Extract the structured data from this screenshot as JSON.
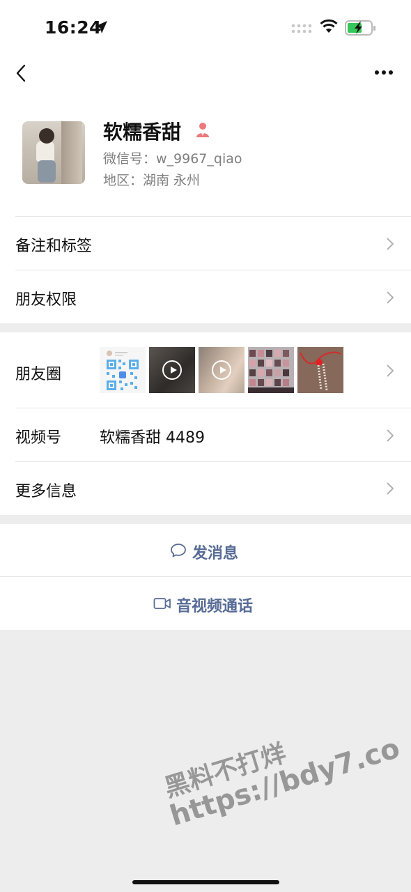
{
  "status_bar": {
    "time": "16:24"
  },
  "profile": {
    "name": "软糯香甜",
    "wechat_id": "微信号：w_9967_qiao",
    "region": "地区：湖南 永州"
  },
  "rows": {
    "remark_tags": "备注和标签",
    "friend_permissions": "朋友权限",
    "moments": "朋友圈",
    "channels": "视频号",
    "channels_value": "软糯香甜 4489",
    "more_info": "更多信息"
  },
  "actions": {
    "send_message": "发消息",
    "av_call": "音视频通话"
  },
  "watermark": {
    "line1": "黑料不打烊",
    "line2": "https://bdy7.co"
  },
  "colors": {
    "accent_link": "#576b95",
    "background": "#ededed",
    "person_icon": "#e9797b"
  }
}
